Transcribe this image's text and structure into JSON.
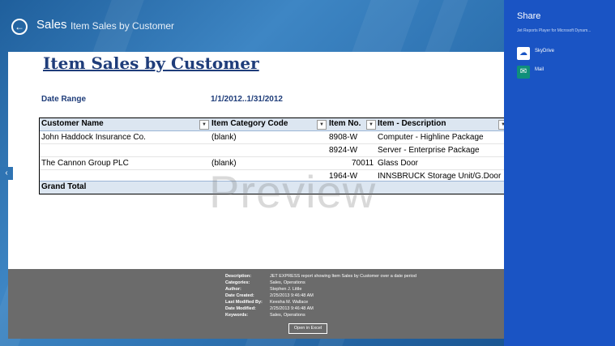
{
  "header": {
    "app": "Sales",
    "page": "Item Sales by Customer"
  },
  "report": {
    "title": "Item Sales by Customer",
    "date_label": "Date Range",
    "date_value": "1/1/2012..1/31/2012",
    "columns": [
      "Customer  Name",
      "Item Category Code",
      "Item No.",
      "Item - Description"
    ],
    "rows": [
      {
        "customer": "John Haddock Insurance Co.",
        "category": "(blank)",
        "item_no": "8908-W",
        "description": "Computer - Highline Package"
      },
      {
        "customer": "",
        "category": "",
        "item_no": "8924-W",
        "description": "Server - Enterprise Package"
      },
      {
        "customer": "The Cannon Group PLC",
        "category": "(blank)",
        "item_no": "70011",
        "description": "Glass Door"
      },
      {
        "customer": "",
        "category": "",
        "item_no": "1964-W",
        "description": "INNSBRUCK Storage Unit/G.Door"
      }
    ],
    "grand_total": "Grand Total",
    "watermark": "Preview"
  },
  "details": [
    {
      "key": "Description:",
      "value": "JET EXPRESS report showing Item Sales by Customer over a date period"
    },
    {
      "key": "Categories:",
      "value": "Sales, Operations"
    },
    {
      "key": "Author:",
      "value": "Stephen J. Little"
    },
    {
      "key": "Date Created:",
      "value": "2/25/2013 9:46:48 AM"
    },
    {
      "key": "Last Modified By:",
      "value": "Keesha M. Wallace"
    },
    {
      "key": "Date Modified:",
      "value": "2/25/2013 9:46:48 AM"
    },
    {
      "key": "Keywords:",
      "value": "Sales, Operations"
    }
  ],
  "open_button": "Open in Excel",
  "share": {
    "title": "Share",
    "subtitle": "Jet Reports Player for Microsoft Dynam...",
    "items": [
      {
        "label": "SkyDrive",
        "icon": "cloud-icon"
      },
      {
        "label": "Mail",
        "icon": "mail-icon"
      }
    ]
  },
  "colors": {
    "accent": "#1a54c4",
    "title": "#1f3d7a",
    "footer": "#6b6b6b"
  }
}
